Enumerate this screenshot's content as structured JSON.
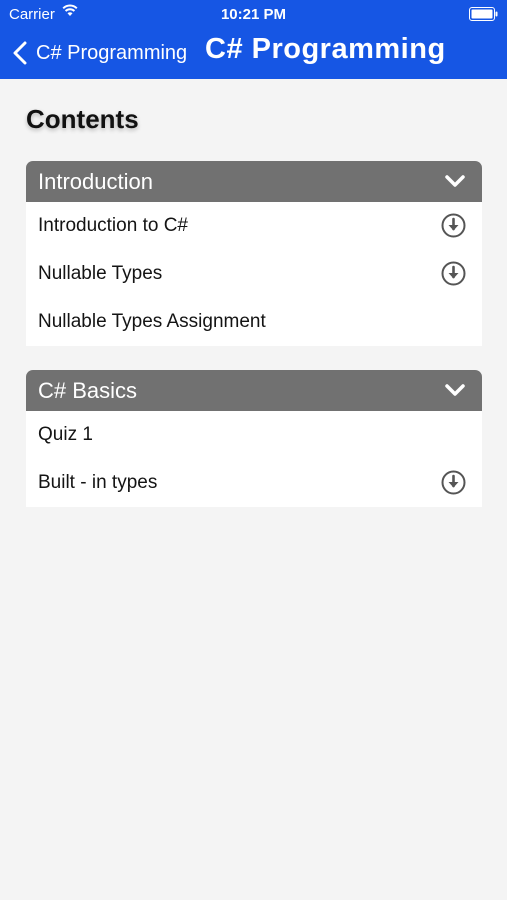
{
  "status_bar": {
    "carrier": "Carrier",
    "time": "10:21 PM",
    "icons": [
      "wifi-icon",
      "battery-icon"
    ]
  },
  "nav": {
    "back_label": "C# Programming",
    "title": "C# Programming",
    "back_icon": "chevron-left-icon"
  },
  "page": {
    "heading": "Contents"
  },
  "sections": [
    {
      "title": "Introduction",
      "icon": "chevron-down-icon",
      "items": [
        {
          "label": "Introduction to C#",
          "download": true
        },
        {
          "label": "Nullable Types",
          "download": true
        },
        {
          "label": "Nullable Types Assignment",
          "download": false
        }
      ]
    },
    {
      "title": "C# Basics",
      "icon": "chevron-down-icon",
      "items": [
        {
          "label": "Quiz 1",
          "download": false
        },
        {
          "label": "Built - in types",
          "download": true
        }
      ]
    }
  ],
  "colors": {
    "nav_background": "#1656e4",
    "section_header": "#717171",
    "page_background": "#f4f4f4",
    "icon_gray": "#555555"
  }
}
